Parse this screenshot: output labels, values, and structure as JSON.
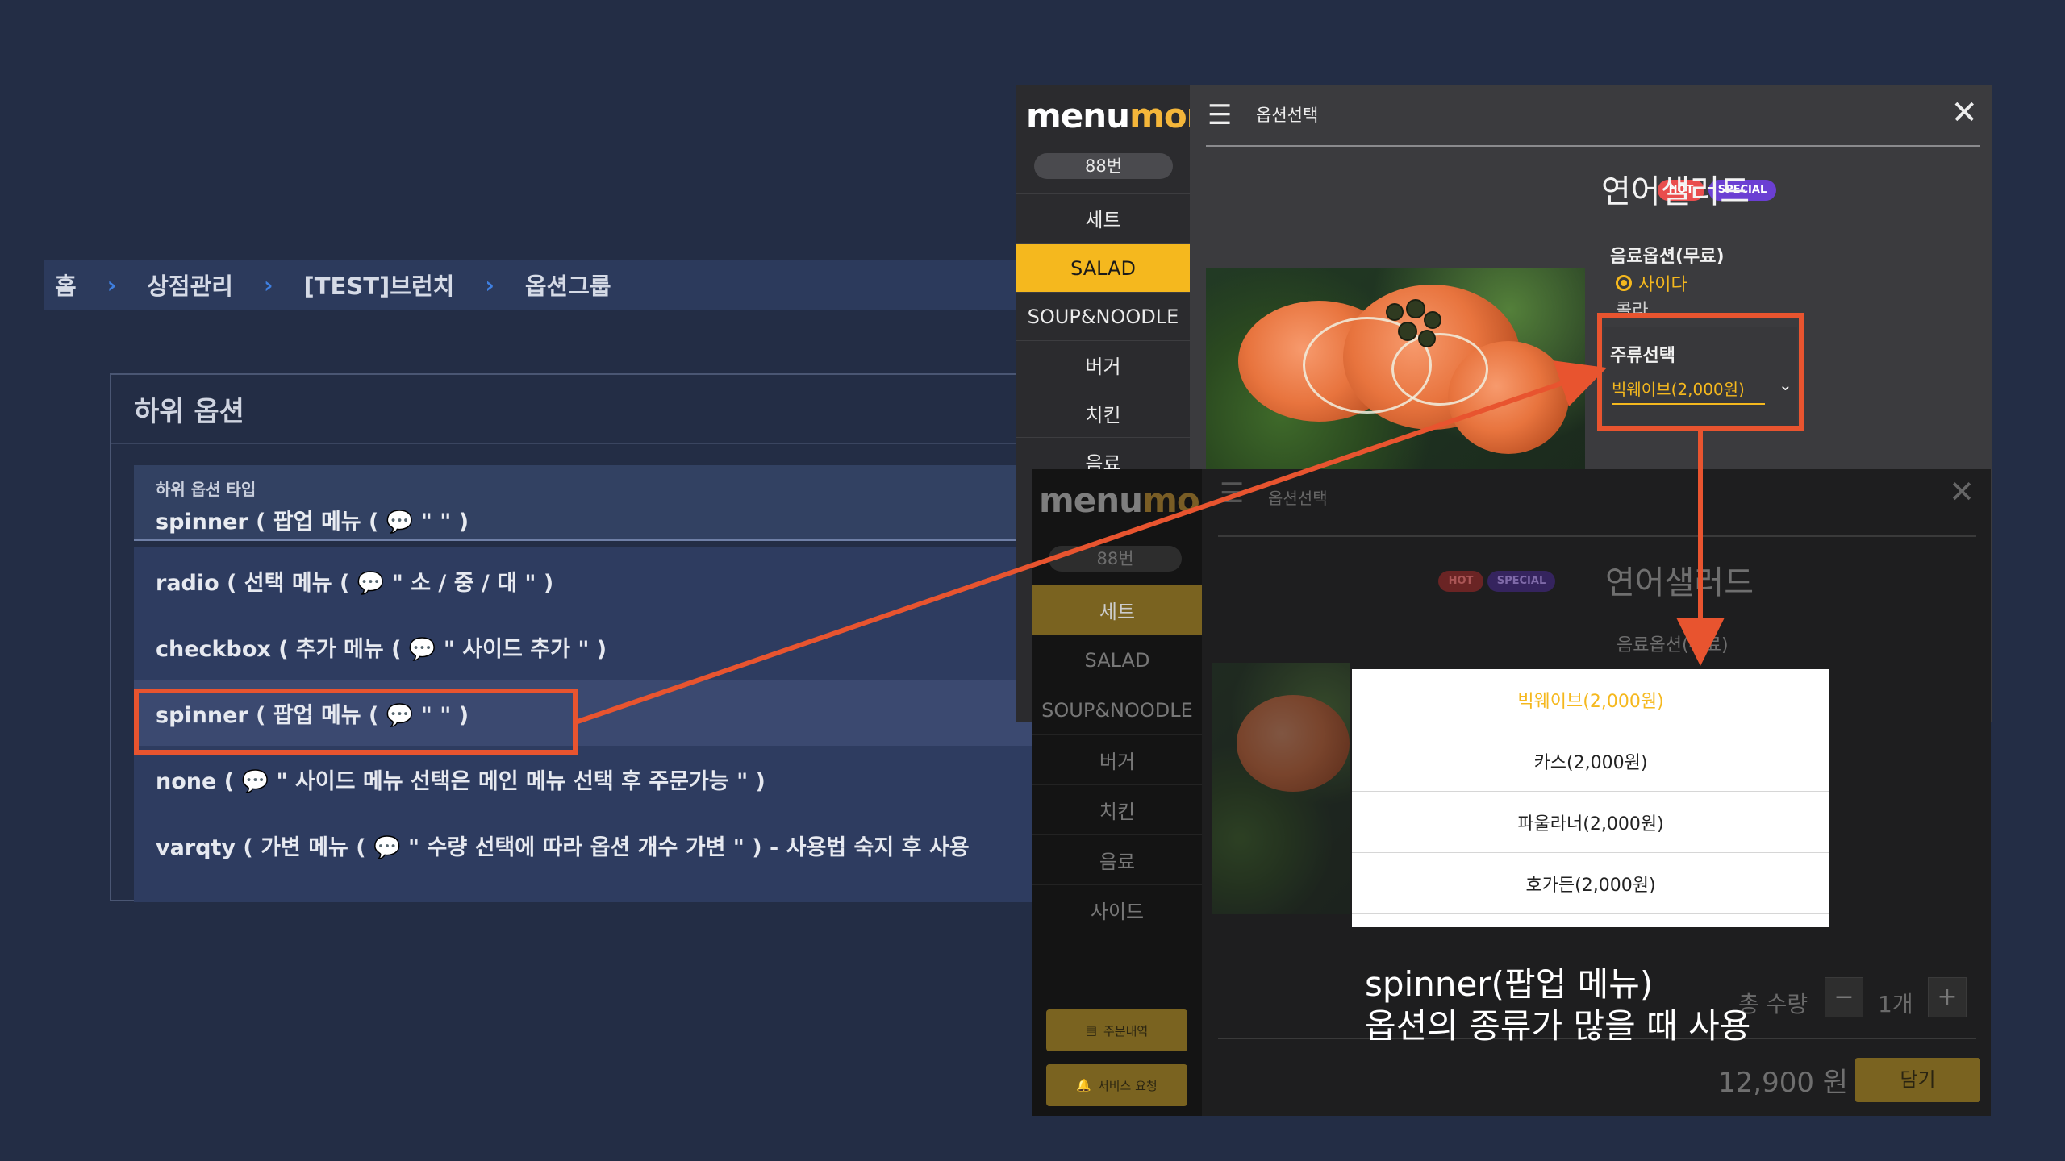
{
  "breadcrumb": {
    "items": [
      "홈",
      "상점관리",
      "[TEST]브런치",
      "옵션그룹"
    ]
  },
  "admin": {
    "card_title": "하위 옵션",
    "select_label": "하위 옵션 타입",
    "select_value": "spinner ( 팝업 메뉴 ( 💬 \" \" )",
    "options": [
      "radio ( 선택 메뉴 ( 💬 \" 소 / 중 / 대 \" )",
      "checkbox ( 추가 메뉴 ( 💬 \" 사이드 추가 \" )",
      "spinner ( 팝업 메뉴 ( 💬 \" \" )",
      "none ( 💬 \" 사이드 메뉴 선택은 메인 메뉴 선택 후 주문가능 \" )",
      "varqty ( 가변 메뉴 ( 💬 \" 수량 선택에 따라 옵션 개수 가변 \" ) - 사용법 숙지 후 사용"
    ],
    "highlighted_index": 2
  },
  "kiosk": {
    "logo_part1": "menu",
    "logo_part2": "mon",
    "table": "88번",
    "header_icon": "list-icon",
    "header_title": "옵션선택",
    "close_icon": "close-icon",
    "categories_1": [
      "세트",
      "SALAD",
      "SOUP&NOODLE",
      "버거",
      "치킨",
      "음료"
    ],
    "categories_2": [
      "세트",
      "SALAD",
      "SOUP&NOODLE",
      "버거",
      "치킨",
      "음료",
      "사이드"
    ],
    "badge_hot": "HOT",
    "badge_special": "SPECIAL",
    "food_title": "연어샐러드",
    "drink_option_label": "음료옵션(무료)",
    "drink_selected": "사이다",
    "drink_other": "콜라",
    "spinner_label": "주류선택",
    "spinner_value": "빅웨이브(2,000원)",
    "spinner_options": [
      "빅웨이브(2,000원)",
      "카스(2,000원)",
      "파울라너(2,000원)",
      "호가든(2,000원)"
    ],
    "order_history": "주문내역",
    "service_request": "서비스 요청",
    "qty_label": "총 수량",
    "qty_value": "1개",
    "minus": "−",
    "plus": "+",
    "price": "12,900 원",
    "add_button": "담기"
  },
  "caption": {
    "line1": "spinner(팝업 메뉴)",
    "line2": "옵션의 종류가 많을 때 사용"
  },
  "colors": {
    "background": "#232d45",
    "accent": "#f5b81e",
    "highlight_box": "#e8542f",
    "hot_badge": "#e94d4d",
    "special_badge": "#6b3fd3"
  }
}
